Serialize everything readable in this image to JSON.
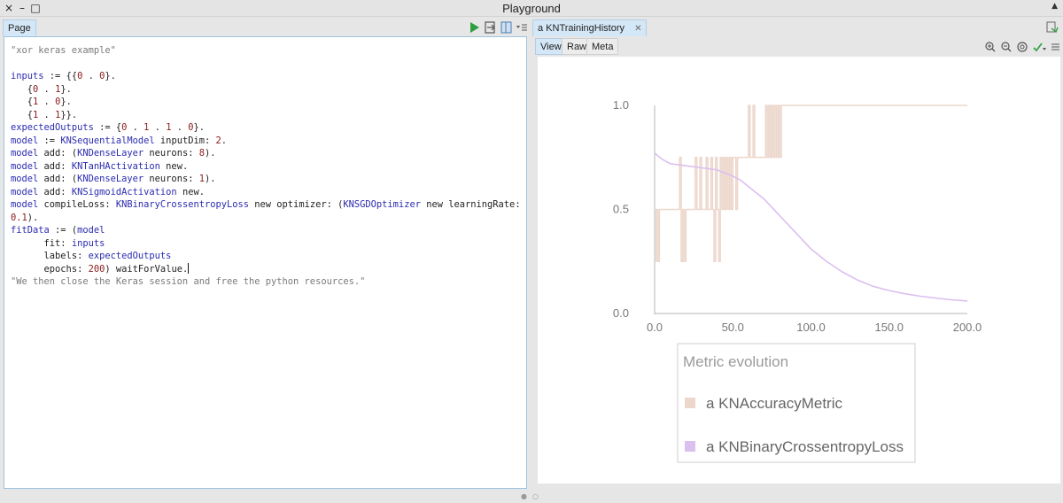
{
  "window": {
    "title": "Playground",
    "controls": {
      "close": "×",
      "minimize": "–",
      "maximize": "□"
    },
    "collapse_arrow": "▲"
  },
  "left": {
    "tab": "Page",
    "toolbar_icons": [
      "play-icon",
      "save-icon",
      "layout-icon",
      "menu-icon"
    ],
    "code_lines": [
      [
        {
          "t": "\"xor keras example\"",
          "c": "comment"
        }
      ],
      [
        {
          "t": "",
          "c": ""
        }
      ],
      [
        {
          "t": "inputs",
          "c": "var"
        },
        {
          "t": " := {{",
          "c": ""
        },
        {
          "t": "0",
          "c": "num"
        },
        {
          "t": " . ",
          "c": ""
        },
        {
          "t": "0",
          "c": "num"
        },
        {
          "t": "}.",
          "c": ""
        }
      ],
      [
        {
          "t": "   {",
          "c": ""
        },
        {
          "t": "0",
          "c": "num"
        },
        {
          "t": " . ",
          "c": ""
        },
        {
          "t": "1",
          "c": "num"
        },
        {
          "t": "}.",
          "c": ""
        }
      ],
      [
        {
          "t": "   {",
          "c": ""
        },
        {
          "t": "1",
          "c": "num"
        },
        {
          "t": " . ",
          "c": ""
        },
        {
          "t": "0",
          "c": "num"
        },
        {
          "t": "}.",
          "c": ""
        }
      ],
      [
        {
          "t": "   {",
          "c": ""
        },
        {
          "t": "1",
          "c": "num"
        },
        {
          "t": " . ",
          "c": ""
        },
        {
          "t": "1",
          "c": "num"
        },
        {
          "t": "}}.",
          "c": ""
        }
      ],
      [
        {
          "t": "expectedOutputs",
          "c": "var"
        },
        {
          "t": " := {",
          "c": ""
        },
        {
          "t": "0",
          "c": "num"
        },
        {
          "t": " . ",
          "c": ""
        },
        {
          "t": "1",
          "c": "num"
        },
        {
          "t": " . ",
          "c": ""
        },
        {
          "t": "1",
          "c": "num"
        },
        {
          "t": " . ",
          "c": ""
        },
        {
          "t": "0",
          "c": "num"
        },
        {
          "t": "}.",
          "c": ""
        }
      ],
      [
        {
          "t": "model",
          "c": "var"
        },
        {
          "t": " := ",
          "c": ""
        },
        {
          "t": "KNSequentialModel",
          "c": "var"
        },
        {
          "t": " inputDim: ",
          "c": ""
        },
        {
          "t": "2",
          "c": "num"
        },
        {
          "t": ".",
          "c": ""
        }
      ],
      [
        {
          "t": "model",
          "c": "var"
        },
        {
          "t": " add: (",
          "c": ""
        },
        {
          "t": "KNDenseLayer",
          "c": "var"
        },
        {
          "t": " neurons: ",
          "c": ""
        },
        {
          "t": "8",
          "c": "num"
        },
        {
          "t": ").",
          "c": ""
        }
      ],
      [
        {
          "t": "model",
          "c": "var"
        },
        {
          "t": " add: ",
          "c": ""
        },
        {
          "t": "KNTanHActivation",
          "c": "var"
        },
        {
          "t": " new.",
          "c": ""
        }
      ],
      [
        {
          "t": "model",
          "c": "var"
        },
        {
          "t": " add: (",
          "c": ""
        },
        {
          "t": "KNDenseLayer",
          "c": "var"
        },
        {
          "t": " neurons: ",
          "c": ""
        },
        {
          "t": "1",
          "c": "num"
        },
        {
          "t": ").",
          "c": ""
        }
      ],
      [
        {
          "t": "model",
          "c": "var"
        },
        {
          "t": " add: ",
          "c": ""
        },
        {
          "t": "KNSigmoidActivation",
          "c": "var"
        },
        {
          "t": " new.",
          "c": ""
        }
      ],
      [
        {
          "t": "model",
          "c": "var"
        },
        {
          "t": " compileLoss: ",
          "c": ""
        },
        {
          "t": "KNBinaryCrossentropyLoss",
          "c": "var"
        },
        {
          "t": " new optimizer: (",
          "c": ""
        },
        {
          "t": "KNSGDOptimizer",
          "c": "var"
        },
        {
          "t": " new learningRate:",
          "c": ""
        }
      ],
      [
        {
          "t": "0.1",
          "c": "num"
        },
        {
          "t": ").",
          "c": ""
        }
      ],
      [
        {
          "t": "fitData",
          "c": "var"
        },
        {
          "t": " := (",
          "c": ""
        },
        {
          "t": "model",
          "c": "var"
        }
      ],
      [
        {
          "t": "      fit: ",
          "c": ""
        },
        {
          "t": "inputs",
          "c": "var"
        }
      ],
      [
        {
          "t": "      labels: ",
          "c": ""
        },
        {
          "t": "expectedOutputs",
          "c": "var"
        }
      ],
      [
        {
          "t": "      epochs: ",
          "c": ""
        },
        {
          "t": "200",
          "c": "num"
        },
        {
          "t": ") waitForValue.",
          "c": ""
        },
        {
          "t": "",
          "c": "caret"
        }
      ],
      [
        {
          "t": "\"We then close the Keras session and free the python resources.\"",
          "c": "comment"
        }
      ]
    ]
  },
  "right": {
    "tab": "a KNTrainingHistory",
    "tab_close": "✕",
    "view_tabs": [
      "View",
      "Raw",
      "Meta"
    ],
    "active_view_tab": "View",
    "toolbar_icons": [
      "zoom-in-icon",
      "zoom-out-icon",
      "zoom-reset-icon",
      "refresh-icon",
      "menu-icon"
    ]
  },
  "chart_data": {
    "type": "line",
    "xlim": [
      0,
      200
    ],
    "ylim": [
      0,
      1
    ],
    "x_ticks": [
      "0.0",
      "50.0",
      "100.0",
      "150.0",
      "200.0"
    ],
    "y_ticks": [
      "0.0",
      "0.5",
      "1.0"
    ],
    "legend_title": "Metric evolution",
    "legend_position": "bottom-center",
    "series": [
      {
        "name": "a KNAccuracyMetric",
        "color": "#ecd7cc",
        "x": [
          0,
          1,
          2,
          3,
          4,
          5,
          6,
          7,
          8,
          9,
          10,
          11,
          12,
          13,
          14,
          15,
          16,
          17,
          18,
          19,
          20,
          21,
          22,
          23,
          24,
          25,
          26,
          27,
          28,
          29,
          30,
          31,
          32,
          33,
          34,
          35,
          36,
          37,
          38,
          39,
          40,
          41,
          42,
          43,
          44,
          45,
          46,
          47,
          48,
          49,
          50,
          51,
          52,
          53,
          54,
          55,
          56,
          57,
          58,
          59,
          60,
          61,
          62,
          63,
          64,
          65,
          66,
          67,
          68,
          69,
          70,
          71,
          72,
          73,
          74,
          75,
          76,
          77,
          78,
          79,
          80,
          81,
          82,
          85,
          90,
          100,
          120,
          150,
          180,
          200
        ],
        "y": [
          0.25,
          0.5,
          0.25,
          0.5,
          0.5,
          0.5,
          0.5,
          0.5,
          0.5,
          0.5,
          0.5,
          0.5,
          0.5,
          0.5,
          0.5,
          0.5,
          0.75,
          0.25,
          0.5,
          0.25,
          0.5,
          0.5,
          0.5,
          0.5,
          0.5,
          0.5,
          0.75,
          0.5,
          0.5,
          0.75,
          0.5,
          0.5,
          0.5,
          0.75,
          0.5,
          0.5,
          0.75,
          0.5,
          0.25,
          0.75,
          0.5,
          0.25,
          0.75,
          0.5,
          0.75,
          0.5,
          0.75,
          0.5,
          0.75,
          0.5,
          0.75,
          0.75,
          0.5,
          0.75,
          0.75,
          0.75,
          0.75,
          0.75,
          0.75,
          0.75,
          1.0,
          0.75,
          0.75,
          1.0,
          0.75,
          0.75,
          0.75,
          0.75,
          0.75,
          0.75,
          0.75,
          1.0,
          0.75,
          1.0,
          0.75,
          1.0,
          0.75,
          1.0,
          0.75,
          1.0,
          0.75,
          1.0,
          1.0,
          1.0,
          1.0,
          1.0,
          1.0,
          1.0,
          1.0,
          1.0
        ]
      },
      {
        "name": "a KNBinaryCrossentropyLoss",
        "color": "#dbbfee",
        "x": [
          0,
          5,
          10,
          20,
          30,
          40,
          50,
          55,
          60,
          65,
          70,
          75,
          80,
          90,
          100,
          110,
          120,
          130,
          140,
          150,
          160,
          170,
          180,
          190,
          200
        ],
        "y": [
          0.77,
          0.74,
          0.72,
          0.71,
          0.7,
          0.69,
          0.66,
          0.64,
          0.61,
          0.58,
          0.55,
          0.51,
          0.47,
          0.39,
          0.31,
          0.25,
          0.2,
          0.16,
          0.13,
          0.11,
          0.095,
          0.083,
          0.074,
          0.066,
          0.06
        ]
      }
    ]
  }
}
